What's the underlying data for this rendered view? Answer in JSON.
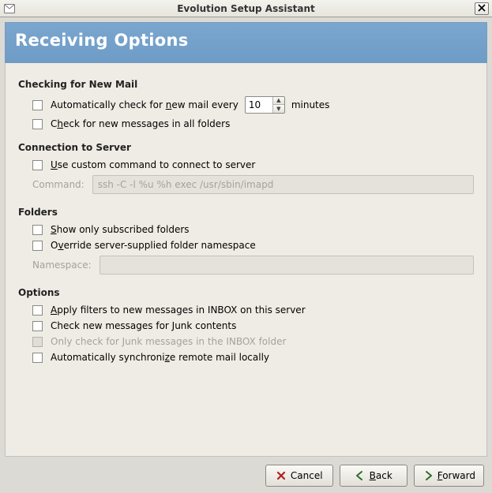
{
  "window": {
    "title": "Evolution Setup Assistant"
  },
  "banner": {
    "heading": "Receiving Options"
  },
  "sections": {
    "checking": {
      "title": "Checking for New Mail",
      "auto_check_prefix": "Automatically check for ",
      "auto_check_mnemonic": "n",
      "auto_check_mid": "ew mail every",
      "interval_value": "10",
      "auto_check_suffix": "minutes",
      "all_folders_prefix": "C",
      "all_folders_mnemonic": "h",
      "all_folders_rest": "eck for new messages in all folders"
    },
    "connection": {
      "title": "Connection to Server",
      "use_custom_mnemonic": "U",
      "use_custom_rest": "se custom command to connect to server",
      "command_label": "Command:",
      "command_value": "ssh -C -l %u %h exec /usr/sbin/imapd"
    },
    "folders": {
      "title": "Folders",
      "subscribed_mnemonic": "S",
      "subscribed_rest": "how only subscribed folders",
      "override_prefix": "O",
      "override_mnemonic": "v",
      "override_rest": "erride server-supplied folder namespace",
      "namespace_label": "Namespace:",
      "namespace_value": ""
    },
    "options": {
      "title": "Options",
      "filters_mnemonic": "A",
      "filters_rest": "pply filters to new messages in INBOX on this server",
      "junk_label": "Check new messages for Junk contents",
      "junk_inbox_label": "Only check for Junk messages in the INBOX folder",
      "sync_prefix": "Automatically synchroni",
      "sync_mnemonic": "z",
      "sync_rest": "e remote mail locally"
    }
  },
  "buttons": {
    "cancel": "Cancel",
    "back_mnemonic": "B",
    "back_rest": "ack",
    "forward_mnemonic": "F",
    "forward_rest": "orward"
  }
}
